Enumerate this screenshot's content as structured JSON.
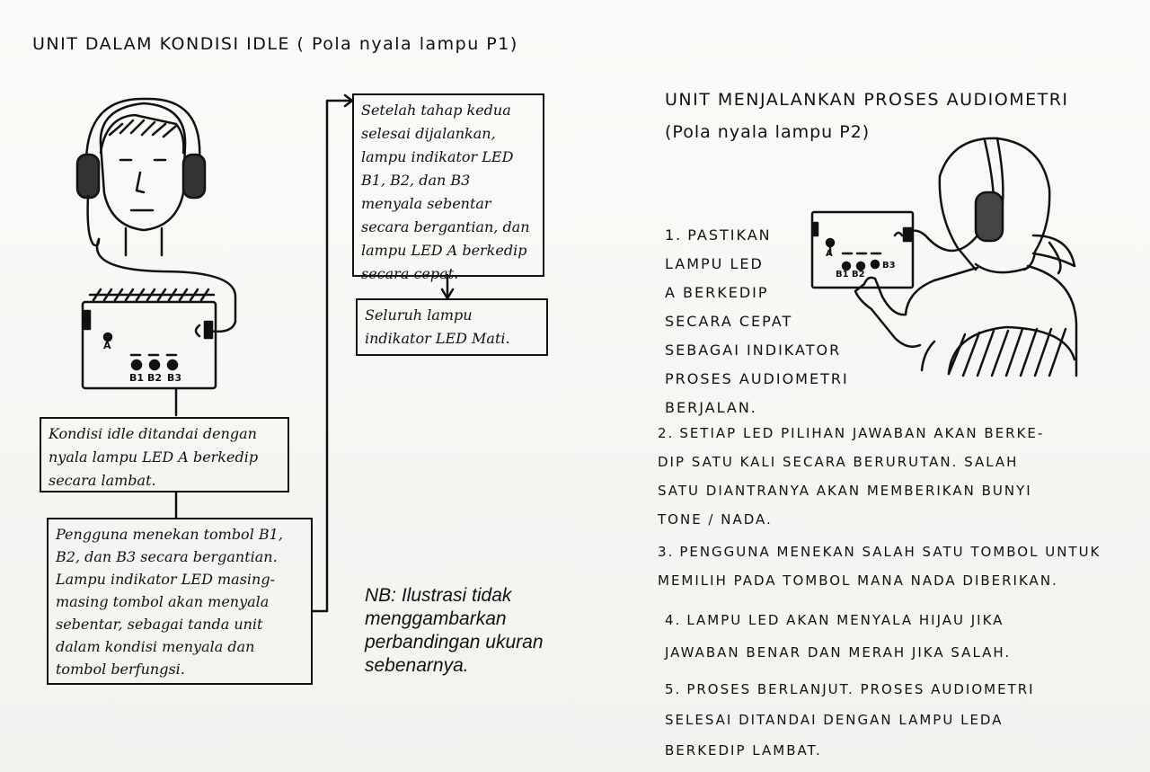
{
  "left": {
    "title": "UNIT DALAM KONDISI IDLE ( Pola nyala lampu P1)",
    "device_labels": {
      "led_a": "A",
      "b1": "B1",
      "b2": "B2",
      "b3": "B3"
    },
    "box_idle": "Kondisi idle ditandai dengan nyala lampu LED A berkedip secara lambat.",
    "box_press": "Pengguna menekan tombol B1, B2, dan B3 secara bergantian. Lampu indikator LED masing-masing tombol akan menyala sebentar, sebagai tanda unit dalam kondisi menyala dan tombol berfungsi.",
    "box_second": "Setelah tahap kedua selesai dijalankan, lampu indikator LED B1, B2, dan B3 menyala sebentar secara bergantian, dan lampu LED A berkedip secara cepat.",
    "box_off": "Seluruh lampu indikator LED Mati."
  },
  "note": "NB: Ilustrasi tidak menggambarkan perbandingan ukuran sebenarnya.",
  "right": {
    "title_line1": "UNIT MENJALANKAN PROSES AUDIOMETRI",
    "title_line2": "(Pola nyala lampu P2)",
    "device_labels": {
      "led_a": "A",
      "b1": "B1",
      "b2": "B2",
      "b3": "B3"
    },
    "steps": [
      {
        "num": "1.",
        "text": "PASTIKAN\nLAMPU LED\nA BERKEDIP\nSECARA CEPAT\nSEBAGAI INDIKATOR\nPROSES AUDIOMETRI\nBERJALAN."
      },
      {
        "num": "2.",
        "text": "SETIAP LED PILIHAN JAWABAN AKAN BERKE-\nDIP SATU KALI SECARA BERURUTAN. SALAH\nSATU DIANTRANYA AKAN MEMBERIKAN BUNYI\nTONE / NADA."
      },
      {
        "num": "3.",
        "text": "PENGGUNA MENEKAN SALAH SATU TOMBOL UNTUK\nMEMILIH PADA TOMBOL MANA NADA DIBERIKAN."
      },
      {
        "num": "4.",
        "text": "LAMPU LED AKAN MENYALA HIJAU JIKA\nJAWABAN BENAR DAN MERAH JIKA SALAH."
      },
      {
        "num": "5.",
        "text": "PROSES BERLANJUT. PROSES AUDIOMETRI\nSELESAI DITANDAI DENGAN LAMPU LEDA\nBERKEDIP LAMBAT."
      }
    ]
  }
}
